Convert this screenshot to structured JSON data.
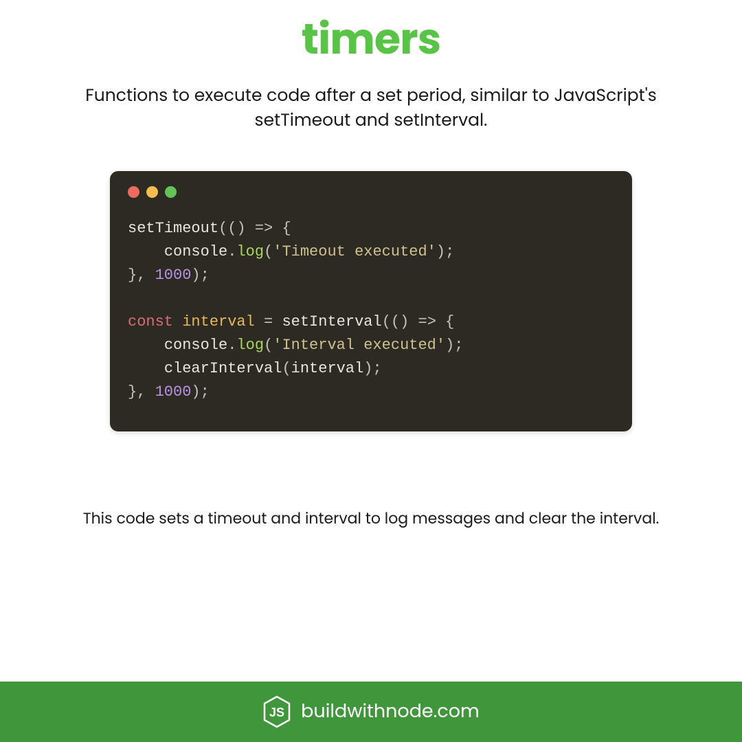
{
  "title": "timers",
  "subtitle": "Functions to execute code after a set period, similar to JavaScript's setTimeout and setInterval.",
  "caption": "This code sets a timeout and interval to log messages and clear the interval.",
  "footer": {
    "site": "buildwithnode.com"
  },
  "code": {
    "line1": {
      "fn": "setTimeout",
      "p1": "((",
      "p2": ")",
      "arrow": " => ",
      "brace": "{"
    },
    "line2": {
      "indent": "    ",
      "obj": "console",
      "dot": ".",
      "method": "log",
      "p1": "(",
      "str": "'Timeout executed'",
      "p2": ");"
    },
    "line3": {
      "brace": "}",
      "comma": ", ",
      "num": "1000",
      "end": ");"
    },
    "line4": "",
    "line5": {
      "kw": "const",
      "sp1": " ",
      "var": "interval",
      "eq": " = ",
      "fn": "setInterval",
      "p1": "((",
      "p2": ")",
      "arrow": " => ",
      "brace": "{"
    },
    "line6": {
      "indent": "    ",
      "obj": "console",
      "dot": ".",
      "method": "log",
      "p1": "(",
      "str": "'Interval executed'",
      "p2": ");"
    },
    "line7": {
      "indent": "    ",
      "fn": "clearInterval",
      "p1": "(",
      "var": "interval",
      "p2": ");"
    },
    "line8": {
      "brace": "}",
      "comma": ", ",
      "num": "1000",
      "end": ");"
    }
  }
}
